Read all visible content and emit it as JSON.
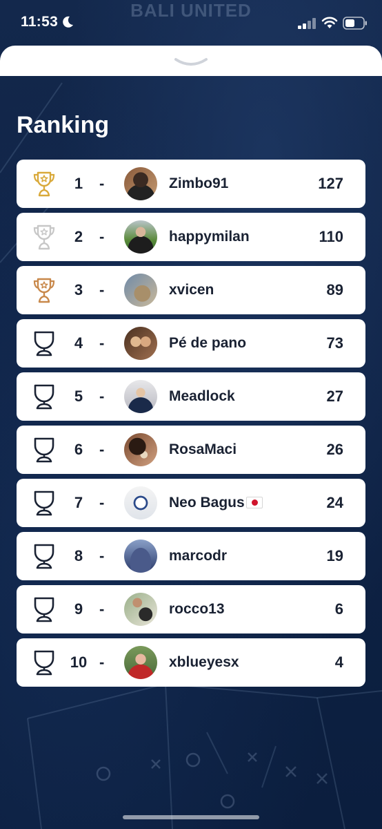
{
  "status_bar": {
    "time": "11:53",
    "brand": "BALI UNITED"
  },
  "page": {
    "title": "Ranking"
  },
  "colors": {
    "gold": "#d9a93a",
    "silver": "#c7c7c7",
    "bronze": "#c8884a",
    "plain": "#1a2233"
  },
  "ranking": [
    {
      "rank": "1",
      "dash": "-",
      "name": "Zimbo91",
      "score": "127",
      "trophy": "gold-trophy-icon",
      "avatar": "avatar-1"
    },
    {
      "rank": "2",
      "dash": "-",
      "name": "happymilan",
      "score": "110",
      "trophy": "silver-trophy-icon",
      "avatar": "avatar-2"
    },
    {
      "rank": "3",
      "dash": "-",
      "name": "xvicen",
      "score": "89",
      "trophy": "bronze-trophy-icon",
      "avatar": "avatar-3"
    },
    {
      "rank": "4",
      "dash": "-",
      "name": "Pé de pano",
      "score": "73",
      "trophy": "trophy-icon",
      "avatar": "avatar-4"
    },
    {
      "rank": "5",
      "dash": "-",
      "name": "Meadlock",
      "score": "27",
      "trophy": "trophy-icon",
      "avatar": "avatar-5"
    },
    {
      "rank": "6",
      "dash": "-",
      "name": "RosaMaci",
      "score": "26",
      "trophy": "trophy-icon",
      "avatar": "avatar-6"
    },
    {
      "rank": "7",
      "dash": "-",
      "name": "Neo Bagus",
      "score": "24",
      "trophy": "trophy-icon",
      "avatar": "avatar-7",
      "flag": "japan-flag-icon"
    },
    {
      "rank": "8",
      "dash": "-",
      "name": "marcodr",
      "score": "19",
      "trophy": "trophy-icon",
      "avatar": "avatar-8"
    },
    {
      "rank": "9",
      "dash": "-",
      "name": "rocco13",
      "score": "6",
      "trophy": "trophy-icon",
      "avatar": "avatar-9"
    },
    {
      "rank": "10",
      "dash": "-",
      "name": "xblueyesx",
      "score": "4",
      "trophy": "trophy-icon",
      "avatar": "avatar-10"
    }
  ]
}
